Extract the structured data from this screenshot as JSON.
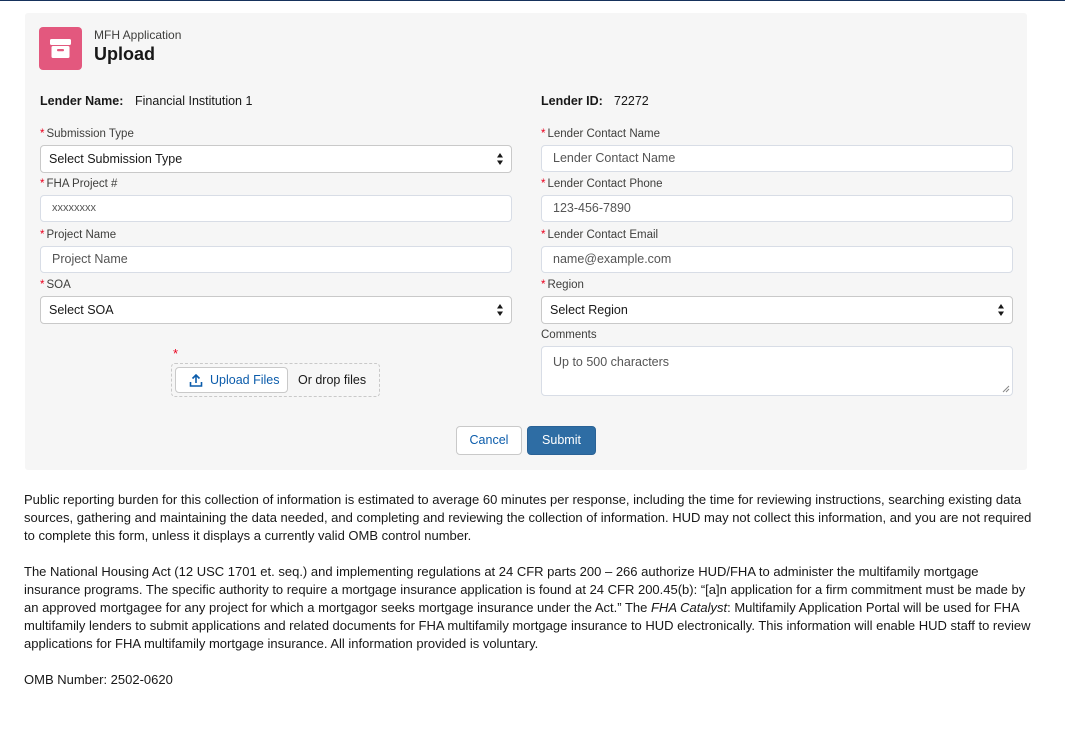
{
  "header": {
    "eyebrow": "MFH Application",
    "title": "Upload",
    "icon": "archive-icon",
    "icon_color": "#e3587e"
  },
  "lender_info": {
    "name_label": "Lender Name:",
    "name_value": "Financial Institution 1",
    "id_label": "Lender ID:",
    "id_value": "72272"
  },
  "form": {
    "submission_type": {
      "label": "Submission Type",
      "value": "Select Submission Type"
    },
    "fha_project": {
      "label": "FHA Project #",
      "placeholder": "xxxxxxxx"
    },
    "project_name": {
      "label": "Project Name",
      "placeholder": "Project Name"
    },
    "soa": {
      "label": "SOA",
      "value": "Select SOA"
    },
    "contact_name": {
      "label": "Lender Contact Name",
      "placeholder": "Lender Contact Name"
    },
    "contact_phone": {
      "label": "Lender Contact Phone",
      "placeholder": "123-456-7890"
    },
    "contact_email": {
      "label": "Lender Contact Email",
      "placeholder": "name@example.com"
    },
    "region": {
      "label": "Region",
      "value": "Select Region"
    },
    "comments": {
      "label": "Comments",
      "placeholder": "Up to 500 characters"
    },
    "required_marker": "*",
    "upload": {
      "button_label": "Upload Files",
      "drop_text": "Or drop files"
    }
  },
  "actions": {
    "cancel_label": "Cancel",
    "submit_label": "Submit",
    "submit_color": "#2e6da4"
  },
  "footer": {
    "burden_statement": "Public reporting burden for this collection of information is estimated to average 60 minutes per response, including the time for reviewing instructions, searching existing data sources, gathering and maintaining the data needed, and completing and reviewing the collection of information. HUD may not collect this information, and you are not required to complete this form, unless it displays a currently valid OMB control number.",
    "authority_part1": "The National Housing Act (12 USC 1701 et. seq.) and implementing regulations at 24 CFR parts 200 – 266 authorize HUD/FHA to administer the multifamily mortgage insurance programs. The specific authority to require a mortgage insurance application is found at 24 CFR 200.45(b): “[a]n application for a firm commitment must be made by an approved mortgagee for any project for which a mortgagor seeks mortgage insurance under the Act.” The ",
    "authority_italic": "FHA Catalyst",
    "authority_part2": ": Multifamily Application Portal will be used for FHA multifamily lenders to submit applications and related documents for FHA multifamily mortgage insurance to HUD electronically. This information will enable HUD staff to review applications for FHA multifamily mortgage insurance. All information provided is voluntary.",
    "omb_number": "OMB Number: 2502-0620"
  }
}
